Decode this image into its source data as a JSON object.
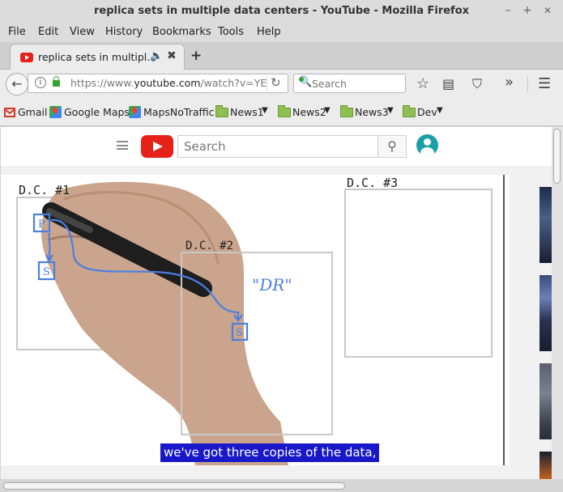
{
  "window": {
    "title": "replica sets in multiple data centers - YouTube - Mozilla Firefox",
    "minimize": "–",
    "maximize": "+",
    "close": "✕"
  },
  "menu": [
    "File",
    "Edit",
    "View",
    "History",
    "Bookmarks",
    "Tools",
    "Help"
  ],
  "tab": {
    "label": "replica sets in multipl...",
    "audio_icon": "speaker-icon",
    "close": "✖",
    "new_tab": "+"
  },
  "nav": {
    "url_prefix": "https://www.",
    "url_domain": "youtube.com",
    "url_rest": "/watch?v=YE",
    "search_placeholder": "Search"
  },
  "bookmarks": [
    "Gmail",
    "Google Maps",
    "MapsNoTraffic",
    "News1",
    "News2",
    "News3",
    "Dev"
  ],
  "youtube": {
    "search_placeholder": "Search",
    "caption": "we've got three copies of the data,"
  },
  "video": {
    "dc1_label": "D.C. #1",
    "dc2_label": "D.C. #2",
    "dc3_label": "D.C. #3",
    "primary_label": "P",
    "secondary_label": "S",
    "dr_label": "\"DR\""
  },
  "colors": {
    "youtube_red": "#e62117",
    "caption_bg": "#1818c8",
    "pen_blue": "#4a7fe0"
  }
}
